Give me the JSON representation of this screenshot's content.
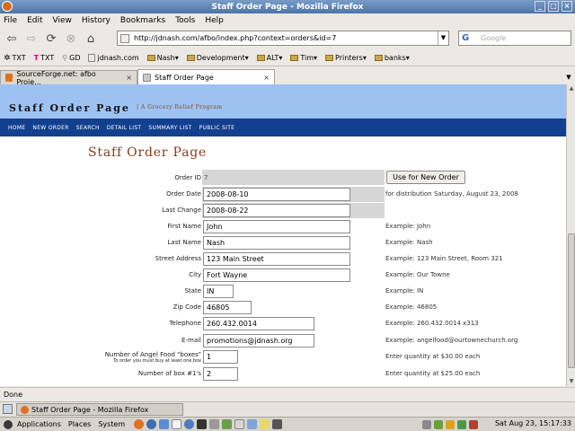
{
  "window": {
    "title": "Staff Order Page - Mozilla Firefox"
  },
  "menu": [
    "File",
    "Edit",
    "View",
    "History",
    "Bookmarks",
    "Tools",
    "Help"
  ],
  "nav": {
    "url": "http://jdnash.com/afbo/index.php?context=orders&id=7",
    "search_placeholder": "Google"
  },
  "bookmarks": [
    {
      "label": "TXT",
      "icon": "gear-icon"
    },
    {
      "label": "TXT",
      "icon": "t-mobile-icon"
    },
    {
      "label": "GD",
      "icon": "gd-icon"
    },
    {
      "label": "jdnash.com",
      "icon": "page-icon"
    },
    {
      "label": "Nash▾",
      "icon": "folder-icon"
    },
    {
      "label": "Development▾",
      "icon": "folder-icon"
    },
    {
      "label": "ALT▾",
      "icon": "folder-icon"
    },
    {
      "label": "Tim▾",
      "icon": "folder-icon"
    },
    {
      "label": "Printers▾",
      "icon": "folder-icon"
    },
    {
      "label": "banks▾",
      "icon": "folder-icon"
    }
  ],
  "tabs": [
    {
      "label": "SourceForge.net: afbo Proje...",
      "active": false
    },
    {
      "label": "Staff Order Page",
      "active": true
    }
  ],
  "site": {
    "title": "Staff Order Page",
    "tagline": "| A Grocery Relief Program",
    "nav": [
      "HOME",
      "NEW ORDER",
      "SEARCH",
      "DETAIL LIST",
      "SUMMARY LIST",
      "PUBLIC SITE"
    ],
    "heading": "Staff Order Page"
  },
  "form": {
    "order_id": {
      "label": "Order ID",
      "value": "7"
    },
    "new_order_button": "Use for New Order",
    "order_date": {
      "label": "Order Date",
      "value": "2008-08-10",
      "note": "for distribution Saturday, August 23, 2008"
    },
    "last_change": {
      "label": "Last Change",
      "value": "2008-08-22"
    },
    "first_name": {
      "label": "First Name",
      "value": "John",
      "example": "Example: John"
    },
    "last_name": {
      "label": "Last Name",
      "value": "Nash",
      "example": "Example: Nash"
    },
    "street": {
      "label": "Street Address",
      "value": "123 Main Street",
      "example": "Example: 123 Main Street, Room 321"
    },
    "city": {
      "label": "City",
      "value": "Fort Wayne",
      "example": "Example: Our Towne"
    },
    "state": {
      "label": "State",
      "value": "IN",
      "example": "Example: IN"
    },
    "zip": {
      "label": "Zip Code",
      "value": "46805",
      "example": "Example: 46805"
    },
    "phone": {
      "label": "Telephone",
      "value": "260.432.0014",
      "example": "Example: 260.432.0014 x313"
    },
    "email": {
      "label": "E-mail",
      "value": "promotions@jdnash.org",
      "example": "Example: angelfood@ourtownechurch.org"
    },
    "angel_boxes": {
      "label": "Number of Angel Food \"boxes\"",
      "sublabel": "To order you must buy at least one box",
      "value": "1",
      "example": "Enter quantity at $30.00 each"
    },
    "box1": {
      "label": "Number of box #1's",
      "value": "2",
      "example": "Enter quantity at $25.00 each"
    }
  },
  "status": "Done",
  "taskbar": {
    "item": "Staff Order Page - Mozilla Firefox"
  },
  "panel": {
    "applications": "Applications",
    "places": "Places",
    "system": "System",
    "clock": "Sat Aug 23, 15:17:33"
  },
  "colors": {
    "banner": "#9dc2f2",
    "sitenav": "#133f8f",
    "heading": "#8a3b1a"
  }
}
